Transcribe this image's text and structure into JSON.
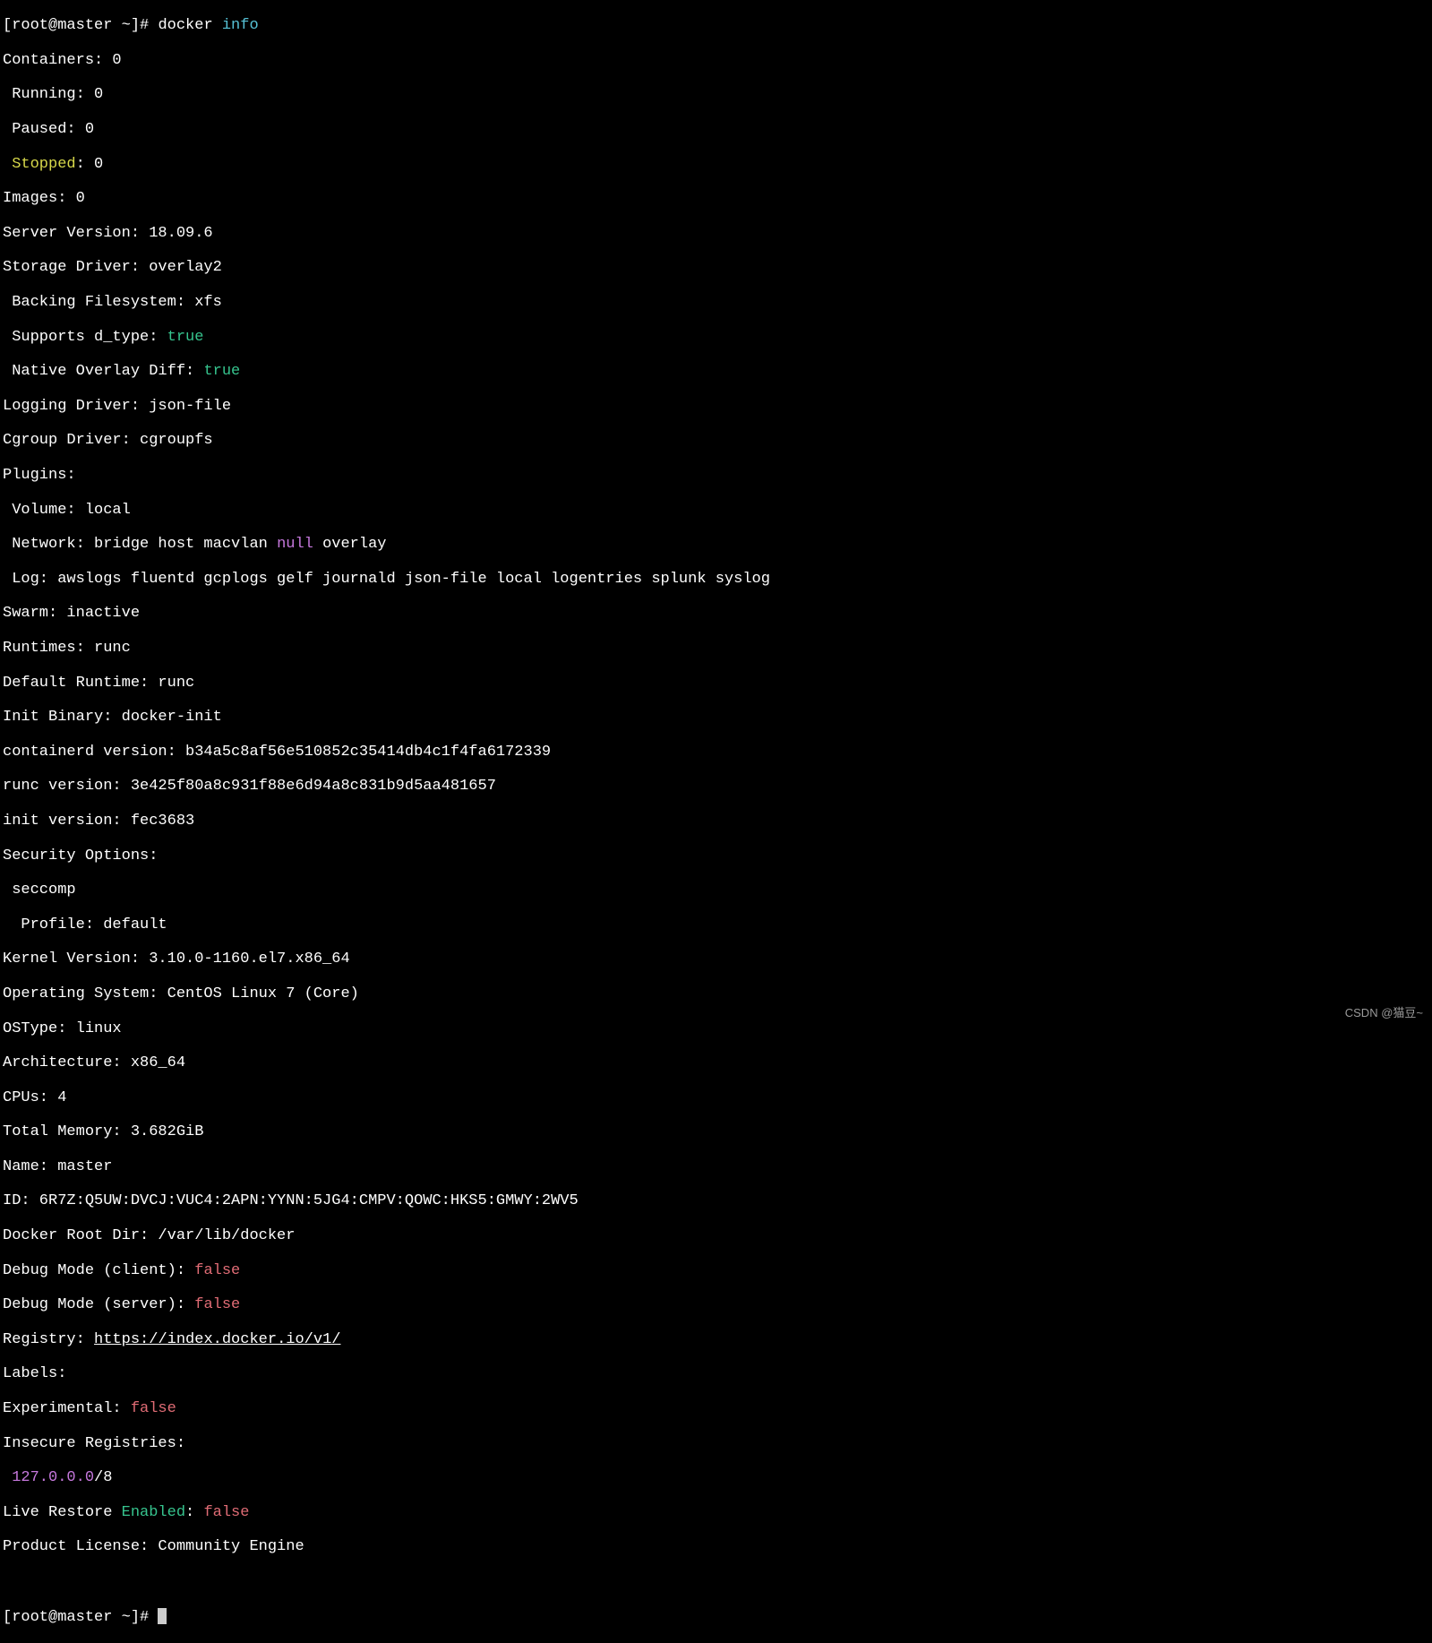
{
  "prompt1": {
    "prefix": "[root@master ~]# ",
    "cmd": "docker ",
    "arg": "info"
  },
  "lines": {
    "containers": "Containers: 0",
    "running": " Running: 0",
    "paused": " Paused: 0",
    "stopped_k": " Stopped",
    "stopped_v": ": 0",
    "images": "Images: 0",
    "server_version": "Server Version: 18.09.6",
    "storage_driver": "Storage Driver: overlay2",
    "backing_fs": " Backing Filesystem: xfs",
    "supports_dtype_k": " Supports d_type: ",
    "supports_dtype_v": "true",
    "native_overlay_k": " Native Overlay Diff: ",
    "native_overlay_v": "true",
    "logging_driver": "Logging Driver: json-file",
    "cgroup_driver": "Cgroup Driver: cgroupfs",
    "plugins": "Plugins:",
    "volume": " Volume: local",
    "network_pre": " Network: bridge host macvlan ",
    "network_null": "null",
    "network_post": " overlay",
    "log": " Log: awslogs fluentd gcplogs gelf journald json-file local logentries splunk syslog",
    "swarm": "Swarm: inactive",
    "runtimes": "Runtimes: runc",
    "default_runtime": "Default Runtime: runc",
    "init_binary": "Init Binary: docker-init",
    "containerd": "containerd version: b34a5c8af56e510852c35414db4c1f4fa6172339",
    "runc": "runc version: 3e425f80a8c931f88e6d94a8c831b9d5aa481657",
    "init_version": "init version: fec3683",
    "security_opts": "Security Options:",
    "seccomp": " seccomp",
    "profile": "  Profile: default",
    "kernel": "Kernel Version: 3.10.0-1160.el7.x86_64",
    "os": "Operating System: CentOS Linux 7 (Core)",
    "ostype": "OSType: linux",
    "arch": "Architecture: x86_64",
    "cpus": "CPUs: 4",
    "total_mem": "Total Memory: 3.682GiB",
    "name": "Name: master",
    "id": "ID: 6R7Z:Q5UW:DVCJ:VUC4:2APN:YYNN:5JG4:CMPV:QOWC:HKS5:GMWY:2WV5",
    "docker_root": "Docker Root Dir: /var/lib/docker",
    "debug_client_k": "Debug Mode (client): ",
    "debug_client_v": "false",
    "debug_server_k": "Debug Mode (server): ",
    "debug_server_v": "false",
    "registry_k": "Registry: ",
    "registry_link": "https://index.docker.io/v1/",
    "labels": "Labels:",
    "experimental_k": "Experimental: ",
    "experimental_v": "false",
    "insecure_reg": "Insecure Registries:",
    "loopback_ip": " 127.0.0.0",
    "loopback_sfx": "/8",
    "live_restore_pre": "Live Restore ",
    "live_restore_mid": "Enabled",
    "live_restore_sep": ": ",
    "live_restore_v": "false",
    "product_license": "Product License: Community Engine"
  },
  "prompt2": "[root@master ~]# ",
  "watermark": "CSDN @猫豆~"
}
